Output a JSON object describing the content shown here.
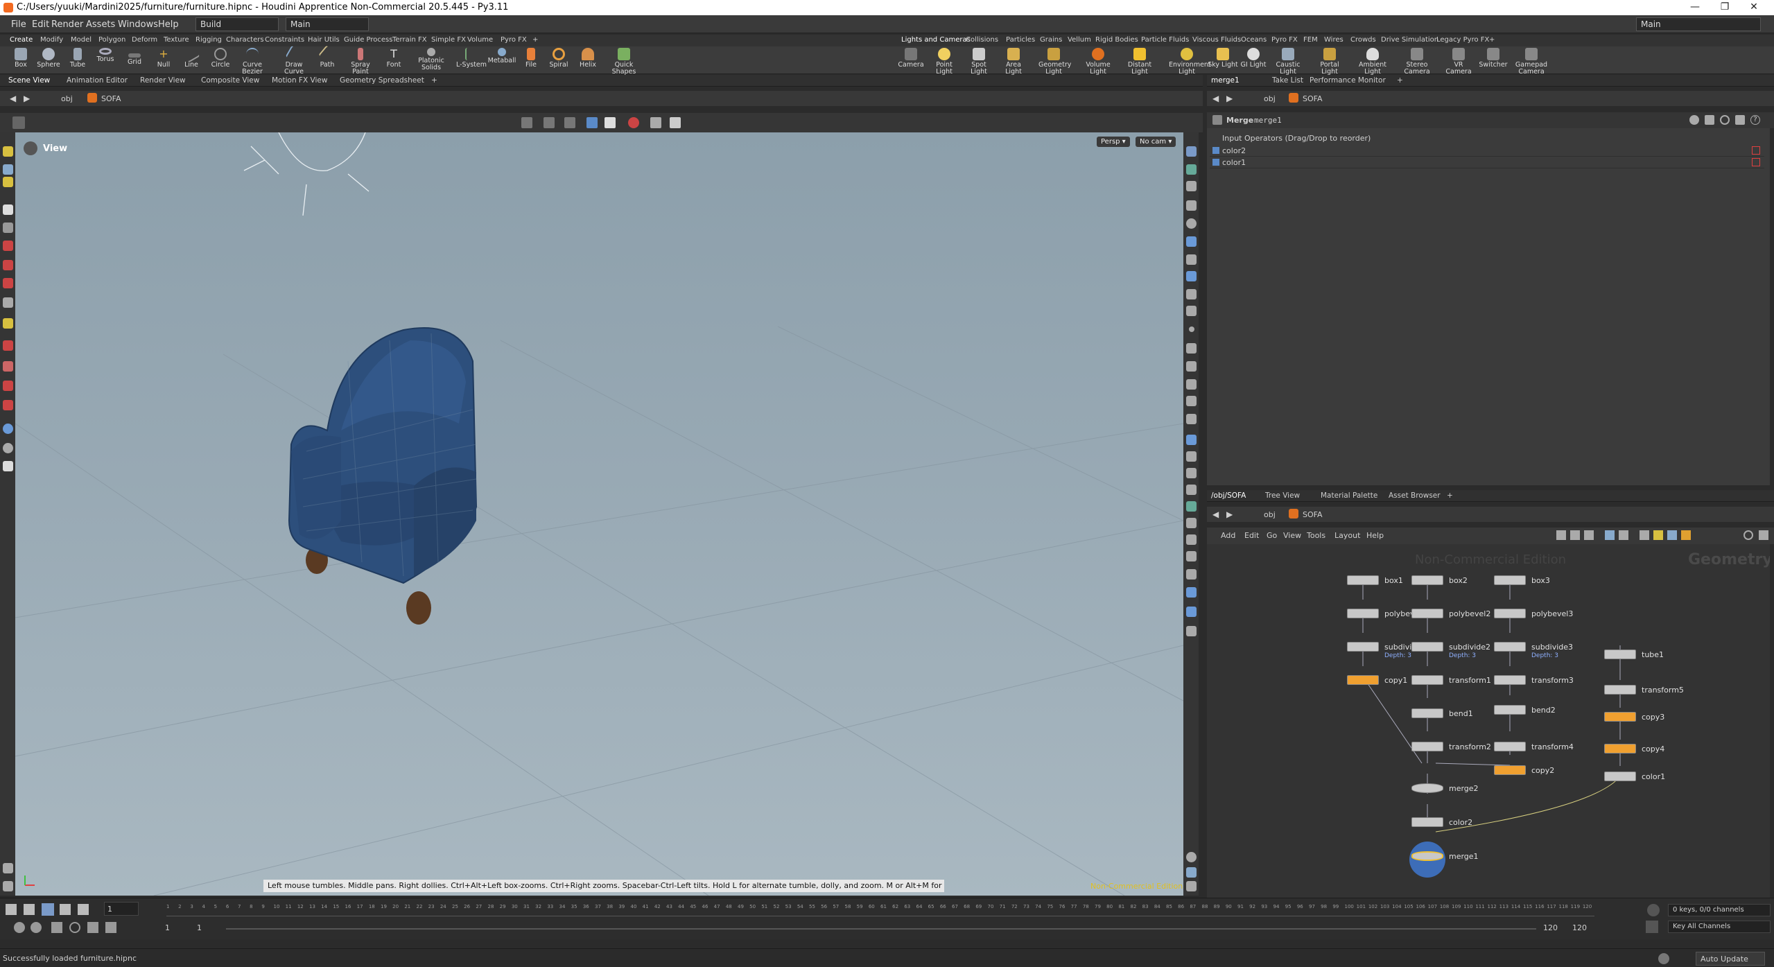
{
  "window": {
    "title": "C:/Users/yuuki/Mardini2025/furniture/furniture.hipnc - Houdini Apprentice Non-Commercial 20.5.445 - Py3.11",
    "min": "—",
    "max": "❐",
    "close": "✕"
  },
  "menubar": {
    "items": [
      "File",
      "Edit",
      "Render",
      "Assets",
      "Windows",
      "Help"
    ],
    "desktop": "Build",
    "network": "Main",
    "right_desktop": "Main"
  },
  "shelf_tabs_left": [
    "Create",
    "Modify",
    "Model",
    "Polygon",
    "Deform",
    "Texture",
    "Rigging",
    "Characters",
    "Constraints",
    "Hair Utils",
    "Guide Process",
    "Terrain FX",
    "Simple FX",
    "Volume",
    "Pyro FX",
    "+"
  ],
  "shelf_tabs_right": [
    "Lights and Cameras",
    "Collisions",
    "Particles",
    "Grains",
    "Vellum",
    "Rigid Bodies",
    "Particle Fluids",
    "Viscous Fluids",
    "Oceans",
    "Pyro FX",
    "FEM",
    "Wires",
    "Crowds",
    "Drive Simulation",
    "Legacy Pyro FX",
    "+"
  ],
  "tools_left": [
    "Box",
    "Sphere",
    "Tube",
    "Torus",
    "Grid",
    "Null",
    "Line",
    "Circle",
    "Curve Bezier",
    "Draw Curve",
    "Path",
    "Spray Paint",
    "Font",
    "Platonic Solids",
    "L-System",
    "Metaball",
    "File",
    "Spiral",
    "Helix",
    "Quick Shapes"
  ],
  "tools_right": [
    "Camera",
    "Point Light",
    "Spot Light",
    "Area Light",
    "Geometry Light",
    "Volume Light",
    "Distant Light",
    "Environment Light",
    "Sky Light",
    "GI Light",
    "Caustic Light",
    "Portal Light",
    "Ambient Light",
    "Stereo Camera",
    "VR Camera",
    "Switcher",
    "Gamepad Camera"
  ],
  "viewer_tabs": [
    "Scene View",
    "Animation Editor",
    "Render View",
    "Composite View",
    "Motion FX View",
    "Geometry Spreadsheet",
    "+"
  ],
  "viewer_path": {
    "context": "obj",
    "node": "SOFA"
  },
  "viewport": {
    "label": "View",
    "camera_mode": "Persp ▾",
    "camera": "No cam ▾",
    "hint": "Left mouse tumbles. Middle pans. Right dollies. Ctrl+Alt+Left box-zooms. Ctrl+Right zooms. Spacebar-Ctrl-Left tilts. Hold L for alternate tumble, dolly, and zoom. M or Alt+M for First Person Navigation.",
    "watermark": "Non-Commercial Edition"
  },
  "param_tabs": [
    "merge1",
    "Take List",
    "Performance Monitor",
    "+"
  ],
  "param_path": {
    "context": "obj",
    "node": "SOFA"
  },
  "params": {
    "type": "Merge",
    "name": "merge1",
    "list_header": "Input Operators (Drag/Drop to reorder)",
    "inputs": [
      "color2",
      "color1"
    ]
  },
  "network_tabs": [
    "/obj/SOFA",
    "Tree View",
    "Material Palette",
    "Asset Browser",
    "+"
  ],
  "network_path": {
    "context": "obj",
    "node": "SOFA"
  },
  "network_menu": [
    "Add",
    "Edit",
    "Go",
    "View",
    "Tools",
    "Layout",
    "Help"
  ],
  "network": {
    "watermark": "Non-Commercial Edition",
    "context_label": "Geometry",
    "nodes": [
      {
        "id": "box1",
        "label": "box1",
        "sub": "",
        "orange": false
      },
      {
        "id": "box2",
        "label": "box2",
        "sub": "",
        "orange": false
      },
      {
        "id": "box3",
        "label": "box3",
        "sub": "",
        "orange": false
      },
      {
        "id": "polybevel1",
        "label": "polybev",
        "sub": "",
        "orange": false
      },
      {
        "id": "polybevel2",
        "label": "polybevel2",
        "sub": "",
        "orange": false
      },
      {
        "id": "polybevel3",
        "label": "polybevel3",
        "sub": "",
        "orange": false
      },
      {
        "id": "subdivide1",
        "label": "subdivid",
        "sub": "Depth: 3",
        "orange": false
      },
      {
        "id": "subdivide2",
        "label": "subdivide2",
        "sub": "Depth: 3",
        "orange": false
      },
      {
        "id": "subdivide3",
        "label": "subdivide3",
        "sub": "Depth: 3",
        "orange": false
      },
      {
        "id": "tube1",
        "label": "tube1",
        "sub": "",
        "orange": false
      },
      {
        "id": "copy1",
        "label": "copy1",
        "sub": "",
        "orange": true
      },
      {
        "id": "transform1",
        "label": "transform1",
        "sub": "",
        "orange": false
      },
      {
        "id": "transform3",
        "label": "transform3",
        "sub": "",
        "orange": false
      },
      {
        "id": "transform5",
        "label": "transform5",
        "sub": "",
        "orange": false
      },
      {
        "id": "bend1",
        "label": "bend1",
        "sub": "",
        "orange": false
      },
      {
        "id": "bend2",
        "label": "bend2",
        "sub": "",
        "orange": false
      },
      {
        "id": "copy3",
        "label": "copy3",
        "sub": "",
        "orange": true
      },
      {
        "id": "transform2",
        "label": "transform2",
        "sub": "",
        "orange": false
      },
      {
        "id": "transform4",
        "label": "transform4",
        "sub": "",
        "orange": false
      },
      {
        "id": "copy4",
        "label": "copy4",
        "sub": "",
        "orange": true
      },
      {
        "id": "copy2",
        "label": "copy2",
        "sub": "",
        "orange": true
      },
      {
        "id": "color1",
        "label": "color1",
        "sub": "",
        "orange": false
      },
      {
        "id": "merge2",
        "label": "merge2",
        "sub": "",
        "orange": false
      },
      {
        "id": "color2",
        "label": "color2",
        "sub": "",
        "orange": false
      },
      {
        "id": "merge1",
        "label": "merge1",
        "sub": "",
        "orange": false
      }
    ]
  },
  "timeline": {
    "current_frame": "1",
    "ticks": [
      "1",
      "2",
      "3",
      "4",
      "5",
      "6",
      "7",
      "8",
      "9",
      "10",
      "11",
      "12",
      "13",
      "14",
      "15",
      "16",
      "17",
      "18",
      "19",
      "20",
      "21",
      "22",
      "23",
      "24",
      "25",
      "26",
      "27",
      "28",
      "29",
      "30",
      "31",
      "32",
      "33",
      "34",
      "35",
      "36",
      "37",
      "38",
      "39",
      "40",
      "41",
      "42",
      "43",
      "44",
      "45",
      "46",
      "47",
      "48",
      "49",
      "50",
      "51",
      "52",
      "53",
      "54",
      "55",
      "56",
      "57",
      "58",
      "59",
      "60",
      "61",
      "62",
      "63",
      "64",
      "65",
      "66",
      "67",
      "68",
      "69",
      "70",
      "71",
      "72",
      "73",
      "74",
      "75",
      "76",
      "77",
      "78",
      "79",
      "80",
      "81",
      "82",
      "83",
      "84",
      "85",
      "86",
      "87",
      "88",
      "89",
      "90",
      "91",
      "92",
      "93",
      "94",
      "95",
      "96",
      "97",
      "98",
      "99",
      "100",
      "101",
      "102",
      "103",
      "104",
      "105",
      "106",
      "107",
      "108",
      "109",
      "110",
      "111",
      "112",
      "113",
      "114",
      "115",
      "116",
      "117",
      "118",
      "119",
      "120"
    ],
    "range_start": "1",
    "range_start2": "1",
    "range_end": "120",
    "range_end2": "120",
    "keys_info": "0 keys, 0/0 channels",
    "key_all": "Key All Channels"
  },
  "status": {
    "message": "Successfully loaded furniture.hipnc",
    "update_mode": "Auto Update"
  },
  "colors": {
    "accent_orange": "#f0a030",
    "viewport_bg": "#98a9b4",
    "sofa_blue": "#2d4f7c",
    "leg_brown": "#5a3a22"
  }
}
